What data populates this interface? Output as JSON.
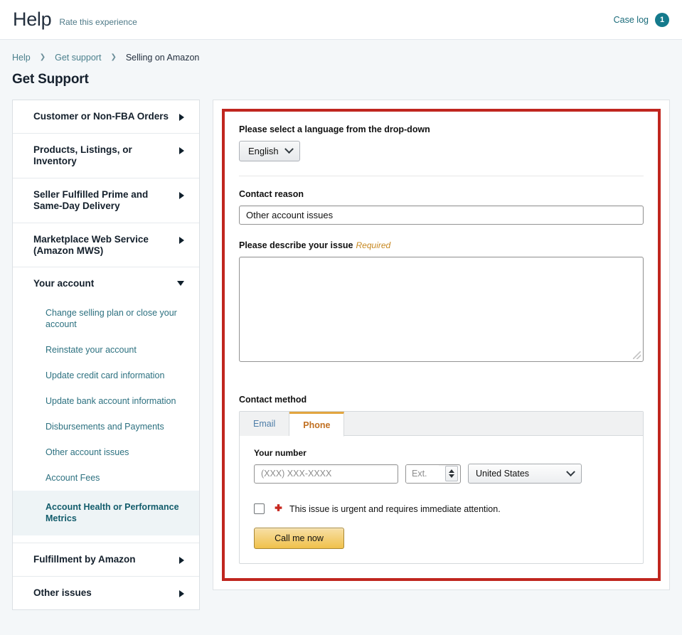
{
  "header": {
    "logo": "Help",
    "rate_link": "Rate this experience",
    "case_log_label": "Case log",
    "case_log_count": "1",
    "badge_color": "#147a8c"
  },
  "breadcrumb": {
    "items": [
      {
        "label": "Help",
        "current": false
      },
      {
        "label": "Get support",
        "current": false
      },
      {
        "label": "Selling on Amazon",
        "current": true
      }
    ],
    "separator": "❯"
  },
  "page_title": "Get Support",
  "sidebar": {
    "groups": [
      {
        "label": "Customer or Non-FBA Orders",
        "expanded": false,
        "caret": "chevron-right-icon"
      },
      {
        "label": "Products, Listings, or Inventory",
        "expanded": false,
        "caret": "chevron-right-icon"
      },
      {
        "label": "Seller Fulfilled Prime and Same-Day Delivery",
        "expanded": false,
        "caret": "chevron-right-icon"
      },
      {
        "label": "Marketplace Web Service (Amazon MWS)",
        "expanded": false,
        "caret": "chevron-right-icon"
      },
      {
        "label": "Your account",
        "expanded": true,
        "caret": "chevron-down-icon"
      },
      {
        "label": "Fulfillment by Amazon",
        "expanded": false,
        "caret": "chevron-right-icon"
      },
      {
        "label": "Other issues",
        "expanded": false,
        "caret": "chevron-right-icon"
      }
    ],
    "your_account_items": [
      {
        "label": "Change selling plan or close your account",
        "selected": false
      },
      {
        "label": "Reinstate your account",
        "selected": false
      },
      {
        "label": "Update credit card information",
        "selected": false
      },
      {
        "label": "Update bank account information",
        "selected": false
      },
      {
        "label": "Disbursements and Payments",
        "selected": false
      },
      {
        "label": "Other account issues",
        "selected": false
      },
      {
        "label": "Account Fees",
        "selected": false
      },
      {
        "label": "Account Health or Performance Metrics",
        "selected": true
      }
    ]
  },
  "form": {
    "highlight_color": "#c0261f",
    "language_label": "Please select a language from the drop-down",
    "language_value": "English",
    "contact_reason_label": "Contact reason",
    "contact_reason_value": "Other account issues",
    "describe_label": "Please describe your issue",
    "describe_required": "Required",
    "describe_value": "",
    "contact_method_label": "Contact method",
    "tabs": [
      {
        "label": "Email",
        "active": false
      },
      {
        "label": "Phone",
        "active": true
      }
    ],
    "your_number_label": "Your number",
    "phone_placeholder": "(XXX) XXX-XXXX",
    "phone_value": "",
    "ext_placeholder": "Ext.",
    "ext_value": "",
    "country_value": "United States",
    "urgent_label": "This issue is urgent and requires immediate attention.",
    "urgent_checked": false,
    "submit_label": "Call me now"
  }
}
